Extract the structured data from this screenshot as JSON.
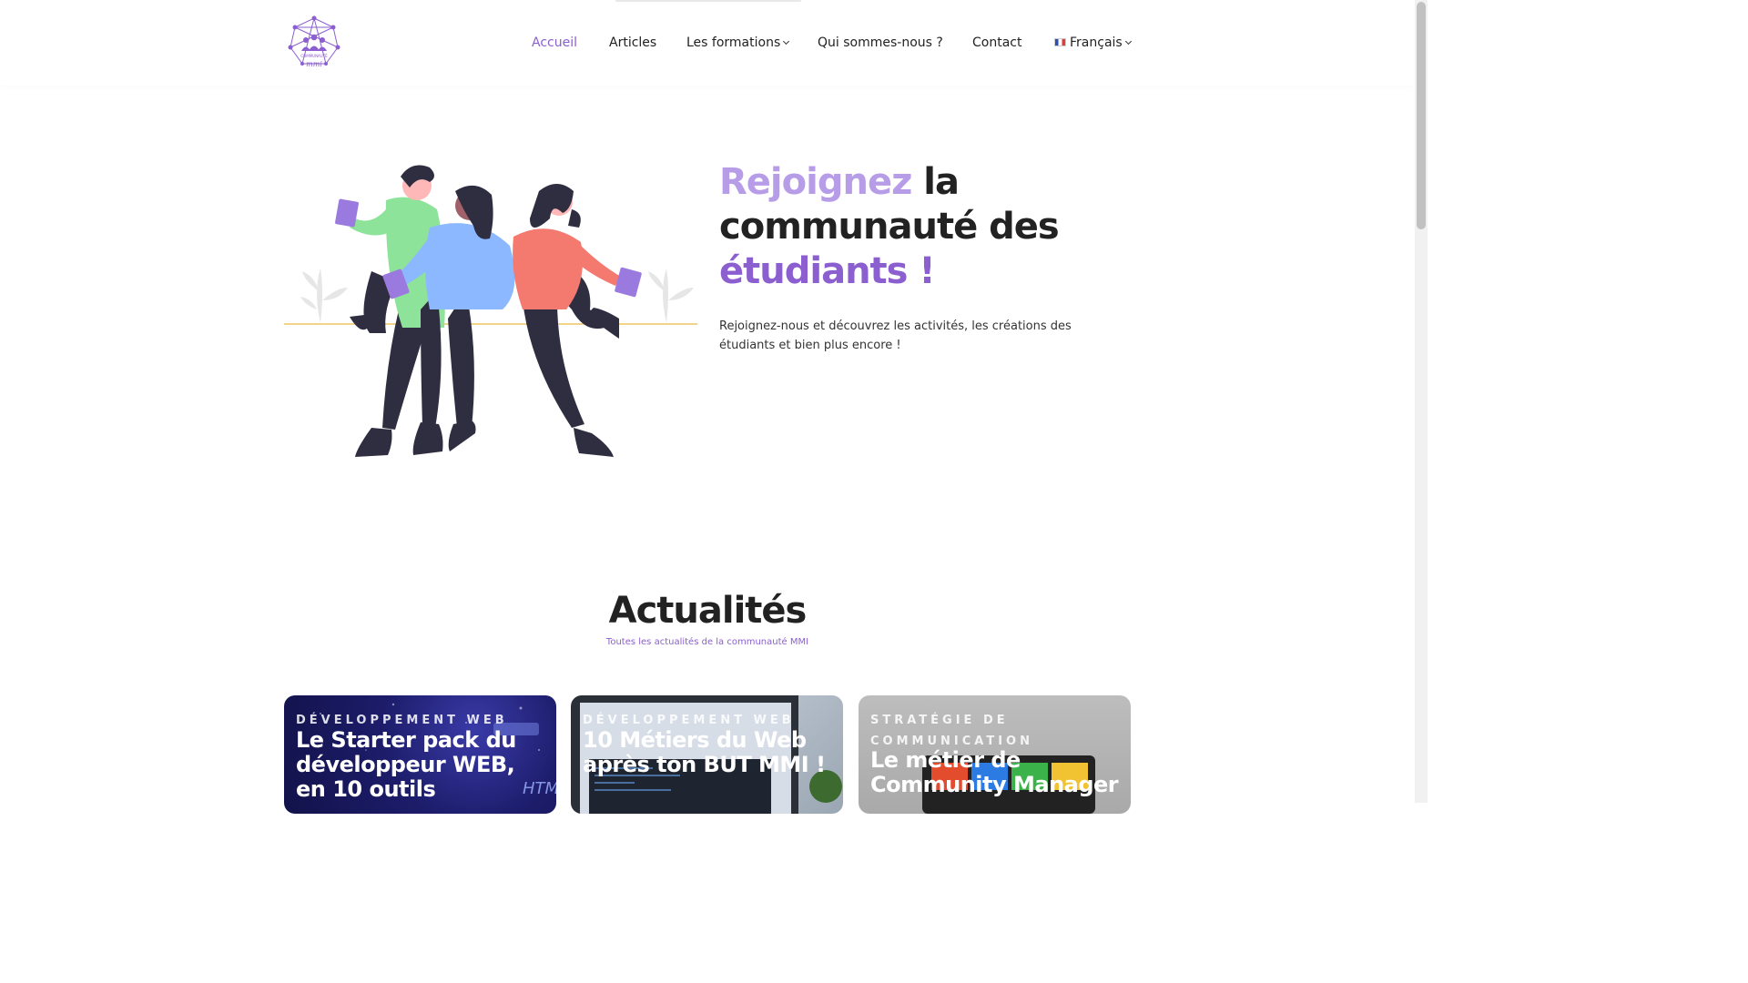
{
  "header": {
    "logo_text": "communauté mmi",
    "nav": [
      {
        "label": "Accueil",
        "active": true
      },
      {
        "label": "Articles"
      },
      {
        "label": "Les formations",
        "dropdown": true
      },
      {
        "label": "Qui sommes-nous ?"
      },
      {
        "label": "Contact"
      },
      {
        "label": "Français",
        "dropdown": true,
        "icon": "france-flag-icon"
      }
    ]
  },
  "hero": {
    "title_part1": "Rejoignez",
    "title_part2": " la communauté des ",
    "title_part3": "étudiants !",
    "text": "Rejoignez-nous et découvrez les activités, les créations des étudiants et bien plus encore !"
  },
  "news": {
    "title": "Actualités",
    "subtitle": "Toutes les actualités de la communauté MMI",
    "cards": [
      {
        "category": "Développement Web",
        "title": "Le Starter pack du développeur WEB, en 10 outils"
      },
      {
        "category": "Développement Web",
        "title": "10 Métiers du Web après ton BUT MMI !"
      },
      {
        "category": "Stratégie de communication",
        "title": "Le métier de Community Manager"
      }
    ]
  },
  "colors": {
    "accent": "#8b5fcf",
    "accent_light": "#b79ce8",
    "text": "#222222"
  }
}
